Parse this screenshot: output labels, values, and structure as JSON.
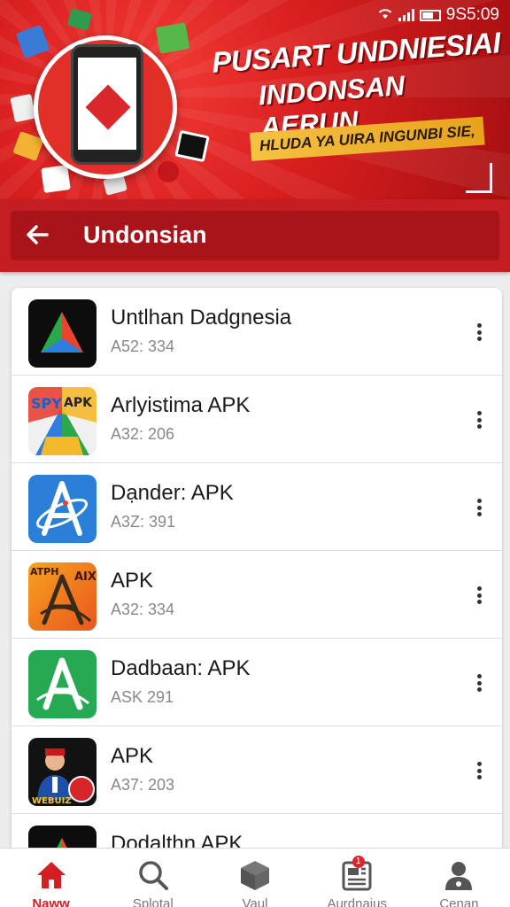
{
  "status_bar": {
    "time": "9S5:09",
    "wifi_icon": "wifi-icon",
    "signal_icon": "signal-icon",
    "battery_icon": "battery-icon"
  },
  "banner": {
    "headline_line1": "PUSART UNDNIESIAI",
    "headline_line2": "INDONSAN AERUN",
    "tagline": "HLUDA YA UIRA INGUNBI SIE,",
    "brand_color": "#d81e1e",
    "accent_color": "#f5c242"
  },
  "header": {
    "back_icon": "arrow-left-icon",
    "title": "Undonsian"
  },
  "apps": [
    {
      "name": "Untlhan Dadgnesia",
      "sub": "A52: 334",
      "icon": "triangle-logo-icon"
    },
    {
      "name": "Arlyistima APK",
      "sub": "A32: 206",
      "icon": "spy-apk-icon",
      "icon_text_left": "SPY",
      "icon_text_right": "APK"
    },
    {
      "name": "Dạnder: APK",
      "sub": "A3Z: 391",
      "icon": "atom-a-icon"
    },
    {
      "name": "APK",
      "sub": "A32: 334",
      "icon": "orange-a-icon",
      "icon_text_left": "ATPH",
      "icon_text_right": "AIX"
    },
    {
      "name": "Dadbaan: APK",
      "sub": "ASK 291",
      "icon": "green-a-icon"
    },
    {
      "name": "APK",
      "sub": "A37: 203",
      "icon": "character-icon",
      "icon_text": "WEBUIZ"
    },
    {
      "name": "Dodalthn APK",
      "sub": "",
      "icon": "triangle-logo-icon"
    }
  ],
  "more_icon": "more-vertical-icon",
  "nav": [
    {
      "label": "Naww",
      "icon": "home-icon",
      "active": true
    },
    {
      "label": "Splotal",
      "icon": "search-icon",
      "active": false
    },
    {
      "label": "Vaul",
      "icon": "box-icon",
      "active": false
    },
    {
      "label": "Aurdnaius",
      "icon": "news-icon",
      "active": false,
      "badge": "1"
    },
    {
      "label": "Cenan",
      "icon": "person-icon",
      "active": false
    }
  ]
}
